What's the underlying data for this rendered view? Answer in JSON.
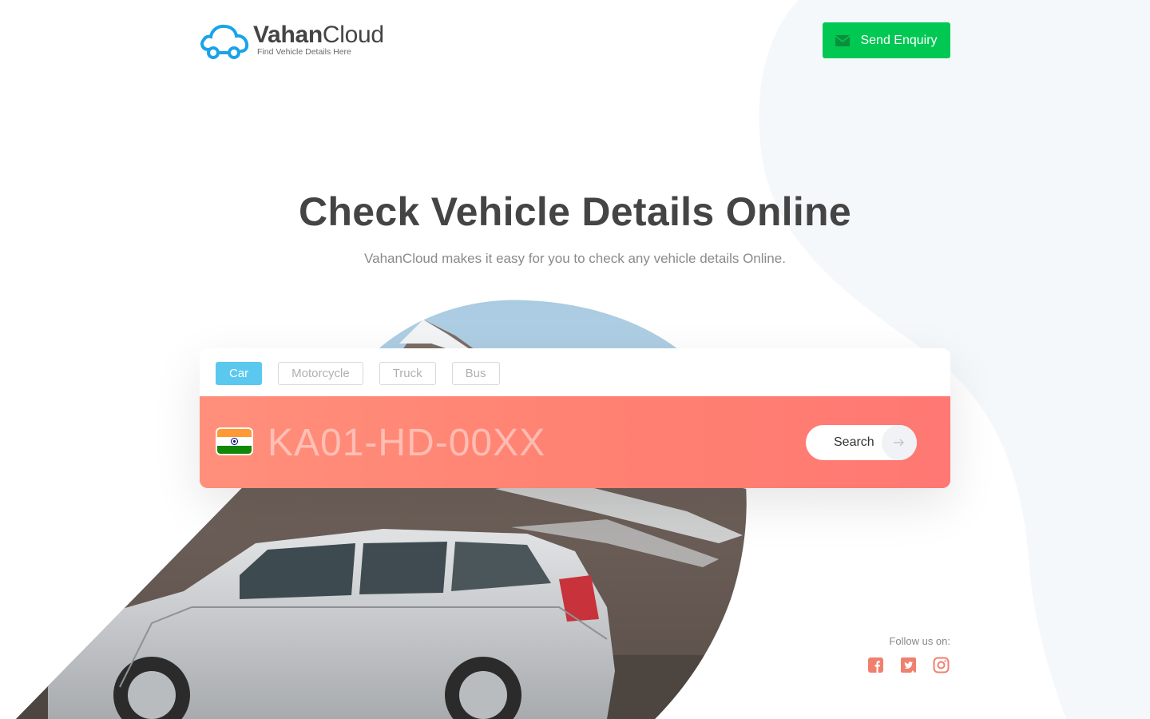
{
  "header": {
    "brand_bold": "Vahan",
    "brand_light": "Cloud",
    "tagline": "Find Vehicle Details Here",
    "enquiry_label": "Send Enquiry",
    "enquiry_icon": "mail-icon"
  },
  "hero": {
    "title": "Check Vehicle Details Online",
    "subtitle": "VahanCloud makes it easy for you to check any vehicle details Online."
  },
  "search": {
    "vehicle_types": [
      {
        "label": "Car",
        "active": true
      },
      {
        "label": "Motorcycle",
        "active": false
      },
      {
        "label": "Truck",
        "active": false
      },
      {
        "label": "Bus",
        "active": false
      }
    ],
    "flag_icon": "india-flag-icon",
    "placeholder": "KA01-HD-00XX",
    "value": "",
    "button_label": "Search",
    "button_icon": "arrow-right-icon"
  },
  "social": {
    "follow_label": "Follow us on:",
    "icons": [
      "facebook-icon",
      "twitter-icon",
      "instagram-icon"
    ]
  },
  "colors": {
    "brand_blue": "#1aa3e8",
    "enquiry_green": "#00c853",
    "plate_gradient_start": "#ff8f7b",
    "plate_gradient_end": "#ff7873",
    "tab_active": "#5bc8ef",
    "social_coral": "#f0806e",
    "blob_bg": "#f5f8fb"
  }
}
